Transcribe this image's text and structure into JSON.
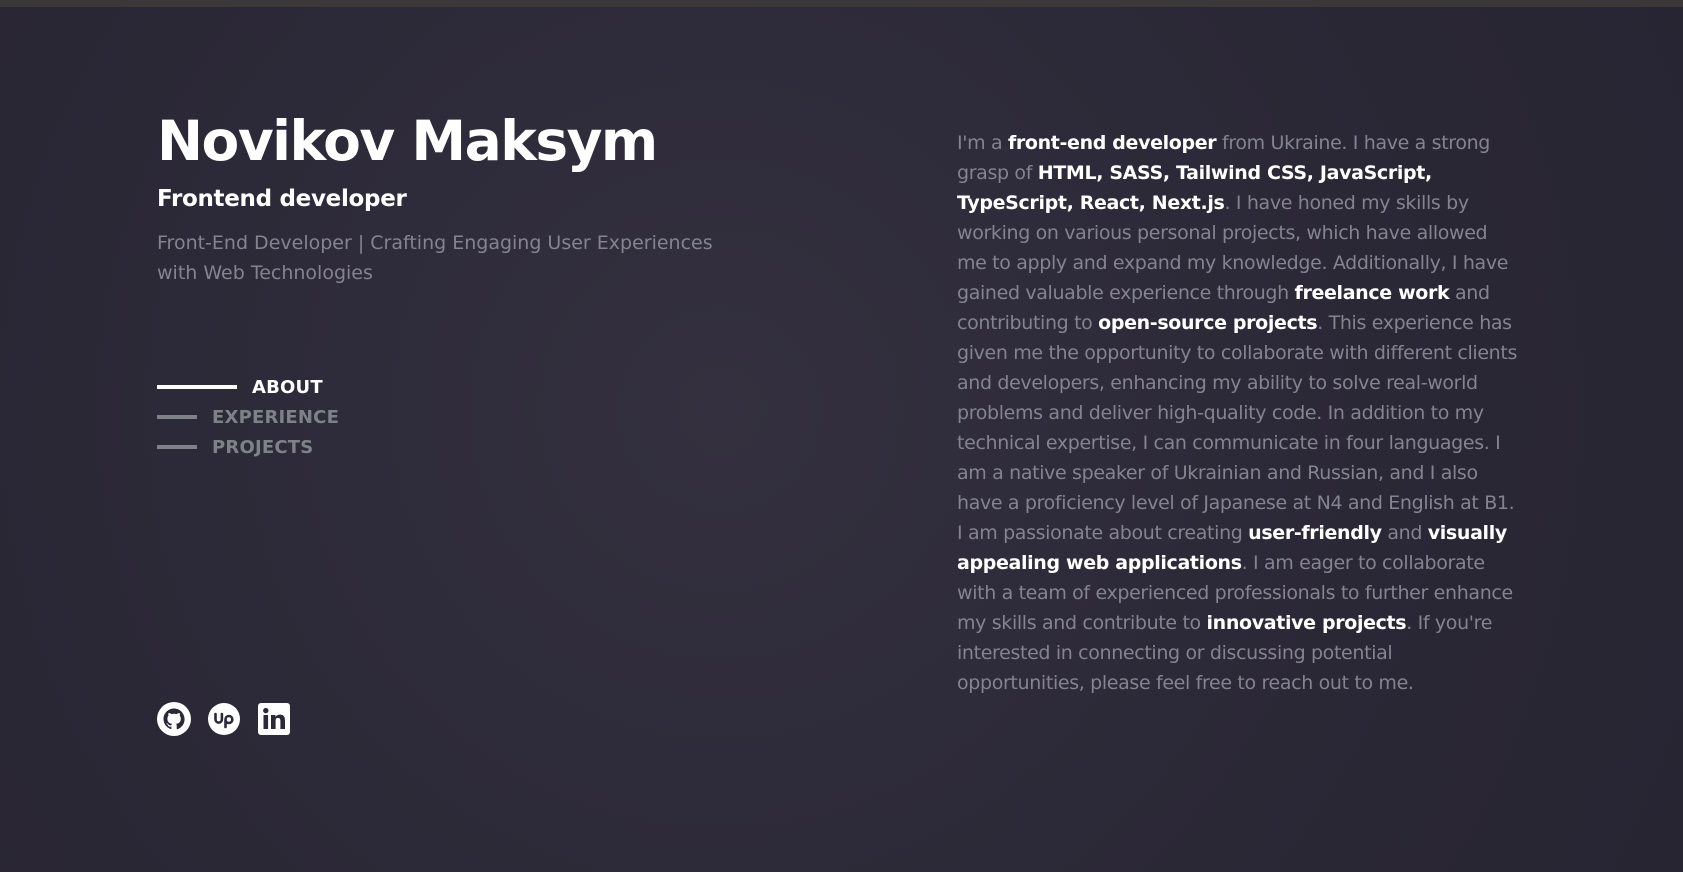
{
  "header": {
    "name": "Novikov Maksym",
    "role": "Frontend developer",
    "tagline": "Front-End Developer | Crafting Engaging User Experiences with Web Technologies"
  },
  "nav": {
    "items": [
      {
        "label": "ABOUT",
        "active": true
      },
      {
        "label": "EXPERIENCE",
        "active": false
      },
      {
        "label": "PROJECTS",
        "active": false
      }
    ]
  },
  "socials": [
    {
      "icon": "github-icon"
    },
    {
      "icon": "upwork-icon"
    },
    {
      "icon": "linkedin-icon"
    }
  ],
  "about": {
    "segments": [
      {
        "text": "I'm a ",
        "highlight": false
      },
      {
        "text": "front-end developer",
        "highlight": true
      },
      {
        "text": " from Ukraine. I have a strong grasp of ",
        "highlight": false
      },
      {
        "text": "HTML, SASS, Tailwind CSS, JavaScript, TypeScript, React, Next.js",
        "highlight": true
      },
      {
        "text": ". I have honed my skills by working on various personal projects, which have allowed me to apply and expand my knowledge. Additionally, I have gained valuable experience through ",
        "highlight": false
      },
      {
        "text": "freelance work",
        "highlight": true
      },
      {
        "text": " and contributing to ",
        "highlight": false
      },
      {
        "text": "open-source projects",
        "highlight": true
      },
      {
        "text": ". This experience has given me the opportunity to collaborate with different clients and developers, enhancing my ability to solve real-world problems and deliver high-quality code. In addition to my technical expertise, I can communicate in four languages. I am a native speaker of Ukrainian and Russian, and I also have a proficiency level of Japanese at N4 and English at B1. I am passionate about creating ",
        "highlight": false
      },
      {
        "text": "user-friendly",
        "highlight": true
      },
      {
        "text": " and ",
        "highlight": false
      },
      {
        "text": "visually appealing web applications",
        "highlight": true
      },
      {
        "text": ". I am eager to collaborate with a team of experienced professionals to further enhance my skills and contribute to ",
        "highlight": false
      },
      {
        "text": "innovative projects",
        "highlight": true
      },
      {
        "text": ". If you're interested in connecting or discussing potential opportunities, please feel free to reach out to me.",
        "highlight": false
      }
    ]
  },
  "colors": {
    "background": "#2b2836",
    "text_primary": "#ffffff",
    "text_muted": "#848491",
    "nav_inactive": "#7e8288"
  }
}
